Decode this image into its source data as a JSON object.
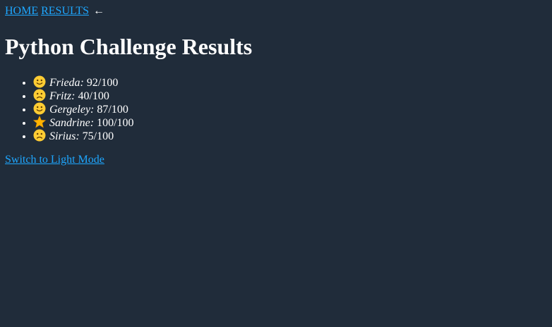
{
  "nav": {
    "home_label": "HOME",
    "results_label": "RESULTS",
    "arrow": "←"
  },
  "page_title": "Python Challenge Results",
  "results": [
    {
      "icon": "slightly-smiling-face-icon",
      "name": "Frieda:",
      "score": "92/100"
    },
    {
      "icon": "slightly-frowning-face-icon",
      "name": "Fritz:",
      "score": "40/100"
    },
    {
      "icon": "slightly-smiling-face-icon",
      "name": "Gergeley:",
      "score": "87/100"
    },
    {
      "icon": "star-icon",
      "name": "Sandrine:",
      "score": "100/100"
    },
    {
      "icon": "slightly-frowning-face-icon",
      "name": "Sirius:",
      "score": "75/100"
    }
  ],
  "theme_toggle_label": "Switch to Light Mode",
  "colors": {
    "background": "#202c3a",
    "link": "#1ea7ff",
    "text": "#ffffff",
    "emoji_face": "#ffcc33",
    "star": "#ffb300"
  }
}
